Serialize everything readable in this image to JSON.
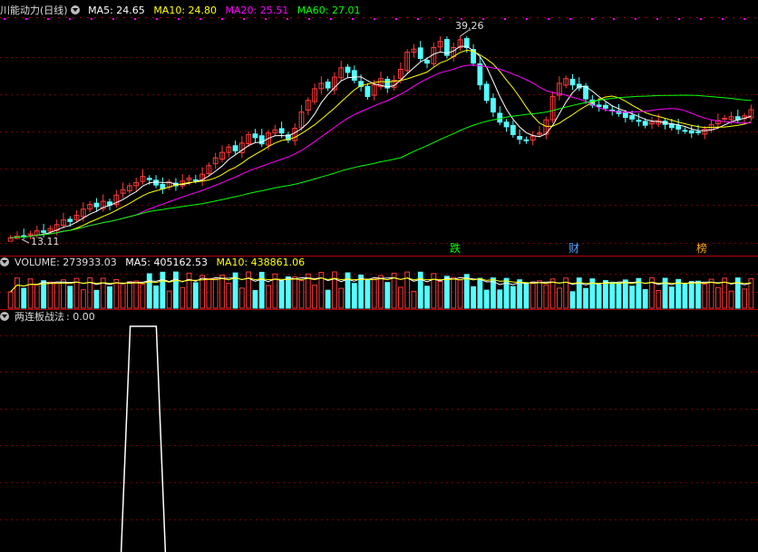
{
  "price_panel": {
    "title": "川能动力(日线)",
    "ma5_label": "MA5: 24.65",
    "ma10_label": "MA10: 24.80",
    "ma20_label": "MA20: 25.51",
    "ma60_label": "MA60: 27.01",
    "high_label": "39.26",
    "low_label": "13.11",
    "event_tags": [
      "跌",
      "财",
      "榜"
    ]
  },
  "volume_panel": {
    "title": "VOLUME: 273933.03",
    "ma5_label": "MA5: 405162.53",
    "ma10_label": "MA10: 438861.06"
  },
  "indicator_panel": {
    "title": "两连板战法",
    "value": ": 0.00"
  },
  "colors": {
    "up": "#ff3a3a",
    "down": "#54ffff",
    "ma5": "#ffffff",
    "ma10": "#ffff00",
    "ma20": "#ff00ff",
    "ma60": "#00ff00",
    "grid": "#8b0000"
  },
  "chart_data": {
    "type": "candlestick",
    "high": 39.26,
    "low": 13.11,
    "ma": {
      "MA5": 24.65,
      "MA10": 24.8,
      "MA20": 25.51,
      "MA60": 27.01
    },
    "closes": [
      13.3,
      13.5,
      13.4,
      13.8,
      14.2,
      14.0,
      14.5,
      15.0,
      15.6,
      15.4,
      16.2,
      17.0,
      17.6,
      17.3,
      18.0,
      17.5,
      18.8,
      19.5,
      20.0,
      20.4,
      21.2,
      20.8,
      20.1,
      19.6,
      20.5,
      20.0,
      20.6,
      21.0,
      20.7,
      21.5,
      22.6,
      23.6,
      24.3,
      25.0,
      24.5,
      25.5,
      26.6,
      26.2,
      25.4,
      26.8,
      27.2,
      26.8,
      25.9,
      27.4,
      29.5,
      31.0,
      32.5,
      33.2,
      32.6,
      34.0,
      35.2,
      34.6,
      33.6,
      32.8,
      31.5,
      33.0,
      33.8,
      32.6,
      33.6,
      35.0,
      37.2,
      37.6,
      36.4,
      35.8,
      37.8,
      38.6,
      36.8,
      37.8,
      38.8,
      37.8,
      35.8,
      33.0,
      31.0,
      29.5,
      28.2,
      27.6,
      26.6,
      26.0,
      25.8,
      26.4,
      26.8,
      28.5,
      31.5,
      33.2,
      33.8,
      33.0,
      32.6,
      31.2,
      30.4,
      30.2,
      30.0,
      29.7,
      29.3,
      28.8,
      28.6,
      28.3,
      27.8,
      28.2,
      28.4,
      27.9,
      27.5,
      27.3,
      27.1,
      26.8,
      26.9,
      27.3,
      27.9,
      28.4,
      28.7,
      28.9,
      28.5,
      29.0,
      29.8
    ],
    "volume": {
      "current": 273933.03,
      "MA5": 405162.53,
      "MA10": 438861.06
    },
    "indicator": {
      "name": "两连板战法",
      "value": 0.0,
      "signal_active_at": [
        18,
        19
      ]
    }
  }
}
